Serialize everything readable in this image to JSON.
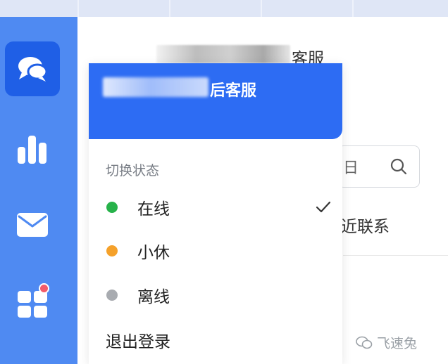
{
  "colors": {
    "sidebar": "#4f8af2",
    "sidebar_active": "#1f5fe6",
    "card": "#2d6cf3",
    "online": "#27b24a",
    "break": "#f5a12a",
    "offline": "#a8abb0",
    "badge": "#f25b6b"
  },
  "sidebar": {
    "items": [
      {
        "icon": "chat-bubbles-icon",
        "active": true
      },
      {
        "icon": "bar-chart-icon",
        "active": false
      },
      {
        "icon": "mail-icon",
        "active": false
      },
      {
        "icon": "apps-grid-icon",
        "active": false,
        "badge": true
      }
    ]
  },
  "header": {
    "agent_suffix": "客服"
  },
  "search": {
    "partial_text": "日",
    "icon": "search-icon"
  },
  "contacts": {
    "label": "近联系"
  },
  "popup": {
    "card_title": "后客服",
    "section_title": "切换状态",
    "statuses": [
      {
        "label": "在线",
        "color_key": "online",
        "selected": true
      },
      {
        "label": "小休",
        "color_key": "break",
        "selected": false
      },
      {
        "label": "离线",
        "color_key": "offline",
        "selected": false
      }
    ],
    "logout_label": "退出登录"
  },
  "watermark": {
    "text": "飞速兔"
  }
}
